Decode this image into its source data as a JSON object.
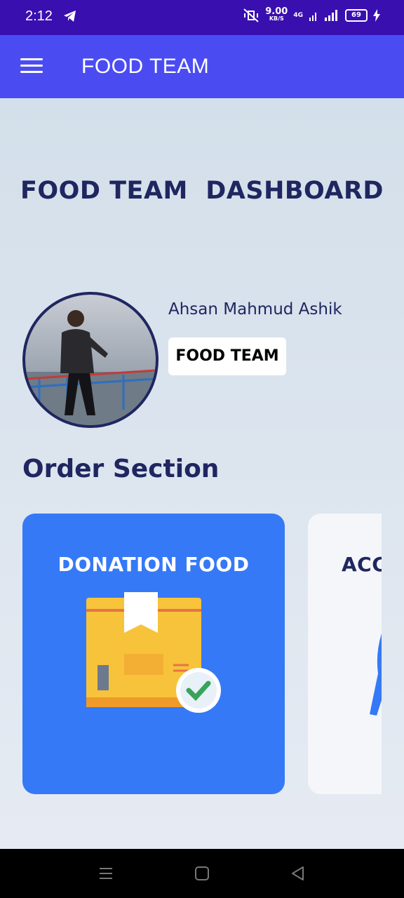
{
  "status_bar": {
    "time": "2:12",
    "net_speed_value": "9.00",
    "net_speed_unit": "KB/S",
    "network_type": "4G",
    "battery": "69"
  },
  "app_bar": {
    "title": "FOOD TEAM"
  },
  "main": {
    "page_title": "FOOD TEAM  DASHBOARD",
    "profile": {
      "name": "Ahsan Mahmud Ashik",
      "role": "FOOD TEAM"
    },
    "section_title": "Order Section",
    "cards": [
      {
        "title": "DONATION FOOD",
        "icon": "package-check-icon",
        "color": "#3579f6"
      },
      {
        "title": "ACCEPTED FOOD",
        "icon": "person-icon",
        "color": "#f4f6f9"
      }
    ]
  },
  "nav_bar": {
    "buttons": [
      "recent-apps-icon",
      "home-icon",
      "back-icon"
    ]
  },
  "colors": {
    "status_bar": "#3a0fb0",
    "app_bar": "#4a4cf2",
    "heading": "#1f2660",
    "card_blue": "#3579f6"
  }
}
